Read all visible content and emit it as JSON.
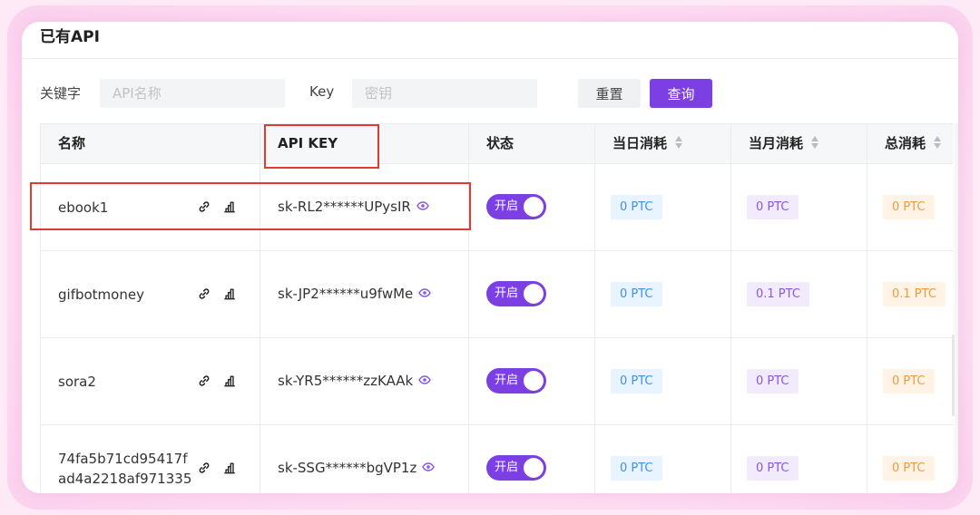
{
  "section": {
    "title": "已有API"
  },
  "filters": {
    "name_label": "关键字",
    "name_placeholder": "API名称",
    "key_label": "Key",
    "key_placeholder": "密钥",
    "reset_label": "重置",
    "query_label": "查询"
  },
  "table": {
    "columns": [
      "名称",
      "API KEY",
      "状态",
      "当日消耗",
      "当月消耗",
      "总消耗"
    ],
    "rows": [
      {
        "name": "ebook1",
        "api_key": "sk-RL2******UPysIR",
        "status": "开启",
        "daily": "0 PTC",
        "monthly": "0 PTC",
        "total": "0 PTC"
      },
      {
        "name": "gifbotmoney",
        "api_key": "sk-JP2******u9fwMe",
        "status": "开启",
        "daily": "0 PTC",
        "monthly": "0.1 PTC",
        "total": "0.1 PTC"
      },
      {
        "name": "sora2",
        "api_key": "sk-YR5******zzKAAk",
        "status": "开启",
        "daily": "0 PTC",
        "monthly": "0 PTC",
        "total": "0 PTC"
      },
      {
        "name": "74fa5b71cd95417fad4a2218af971335",
        "api_key": "sk-SSG******bgVP1z",
        "status": "开启",
        "daily": "0 PTC",
        "monthly": "0 PTC",
        "total": "0 PTC"
      }
    ]
  },
  "colors": {
    "accent": "#7b3fe4",
    "highlight_box": "#e03a32",
    "daily_tag_text": "#3f8ff7",
    "monthly_tag_text": "#8a56e8",
    "total_tag_text": "#f29a3a"
  },
  "icons": {
    "link": "link-icon",
    "stats": "bar-chart-icon",
    "view": "eye-icon",
    "sort": "sort-icon"
  }
}
